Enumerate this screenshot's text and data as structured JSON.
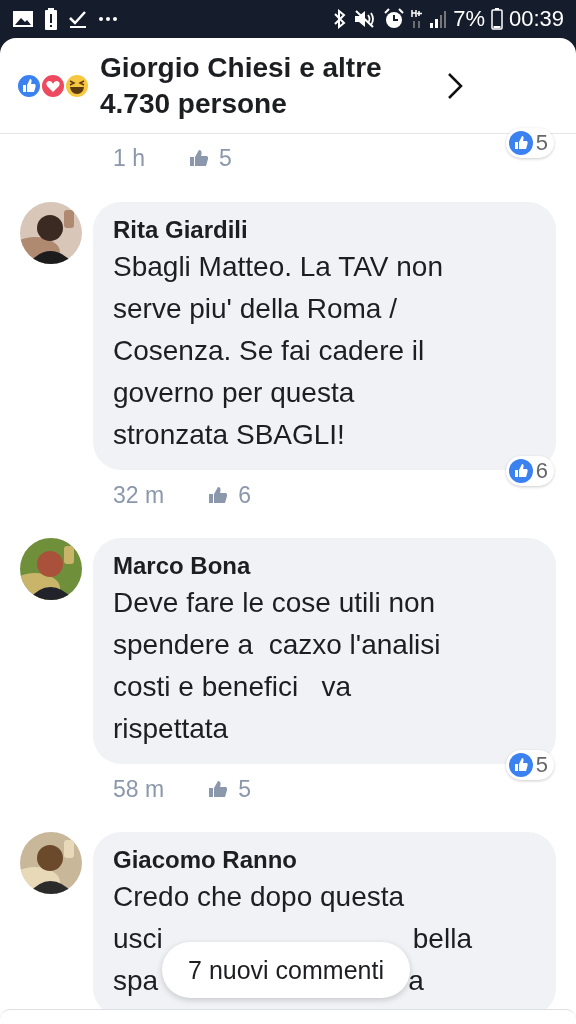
{
  "status_bar": {
    "battery": "7%",
    "time": "00:39"
  },
  "header": {
    "title": "Giorgio Chiesi e altre 4.730 persone"
  },
  "comments": [
    {
      "kind": "meta_only",
      "time": "1 h",
      "likes": "5",
      "reactions": "5"
    },
    {
      "kind": "full",
      "name": "Rita Giardili",
      "text": "Sbagli Matteo. La TAV non serve piu' della Roma / Cosenza. Se fai cadere il governo per questa stronzata SBAGLI!",
      "time": "32 m",
      "likes": "6",
      "reactions": "6"
    },
    {
      "kind": "full",
      "name": "Marco Bona",
      "text": "Deve fare le cose utili non spendere a  cazxo l'analisi costi e benefici   va rispettata",
      "time": "58 m",
      "likes": "5",
      "reactions": "5"
    },
    {
      "kind": "covered",
      "name": "Giacomo Ranno",
      "lines": [
        {
          "left": "Credo che dopo questa"
        },
        {
          "left": "usci",
          "right": "bella"
        },
        {
          "left": "spa",
          "right": "a"
        }
      ]
    }
  ],
  "new_comments_pill": {
    "label": "7 nuovi commenti"
  }
}
